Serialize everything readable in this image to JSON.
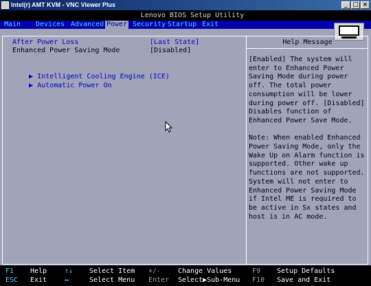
{
  "window": {
    "title": "Intel(r) AMT KVM - VNC Viewer Plus",
    "buttons": [
      "_",
      "□",
      "×"
    ]
  },
  "bios": {
    "title": "Lenovo BIOS Setup Utility",
    "menu": [
      "Main",
      "Devices",
      "Advanced",
      "Power",
      "Security",
      "Startup",
      "Exit"
    ],
    "active_menu": "Power",
    "settings": [
      {
        "label": "After Power Loss",
        "value": "[Last State]"
      },
      {
        "label": "Enhanced Power Saving Mode",
        "value": "[Disabled]"
      }
    ],
    "submenus": [
      {
        "marker": "▶",
        "label": "Intelligent Cooling Engine (ICE)"
      },
      {
        "marker": "▶",
        "label": "Automatic Power On"
      }
    ],
    "help": {
      "title": "Help Message",
      "paragraphs": [
        "[Enabled] The system will enter to Enhanced Power Saving Mode during power off. The total power consumption will be lower during power off. [Disabled] Disables function of Enhanced Power Save Mode.",
        "Note: When enabled Enhanced Power Saving Mode, only the Wake Up on Alarm function is supported. Other wake up functions are not supported. System will not enter to Enhanced Power Saving Mode if Intel ME is required to be active in Sx states and host is in AC mode."
      ]
    },
    "footer": {
      "row1": [
        {
          "key": "F1",
          "desc": "Help"
        },
        {
          "key": "↑↓",
          "desc": "Select Item"
        },
        {
          "key": "+/-",
          "desc": "Change Values"
        },
        {
          "key": "F9",
          "desc": "Setup Defaults"
        }
      ],
      "row2": [
        {
          "key": "ESC",
          "desc": "Exit"
        },
        {
          "key": "↔",
          "desc": "Select Menu"
        },
        {
          "key": "Enter",
          "desc": "Select▶Sub-Menu"
        },
        {
          "key": "F10",
          "desc": "Save and Exit"
        }
      ]
    }
  },
  "colors": {
    "background": "#a0a4b9",
    "menubar": "#0000a8",
    "menu_text": "#55d5ff",
    "item_blue": "#0000c8",
    "footer_key": "#55d5ff",
    "footer_text": "#ffffff"
  },
  "icons": {
    "app": "vnc-app-icon",
    "monitor": "lenovo-monitor-icon",
    "cursor": "mouse-pointer-icon"
  }
}
